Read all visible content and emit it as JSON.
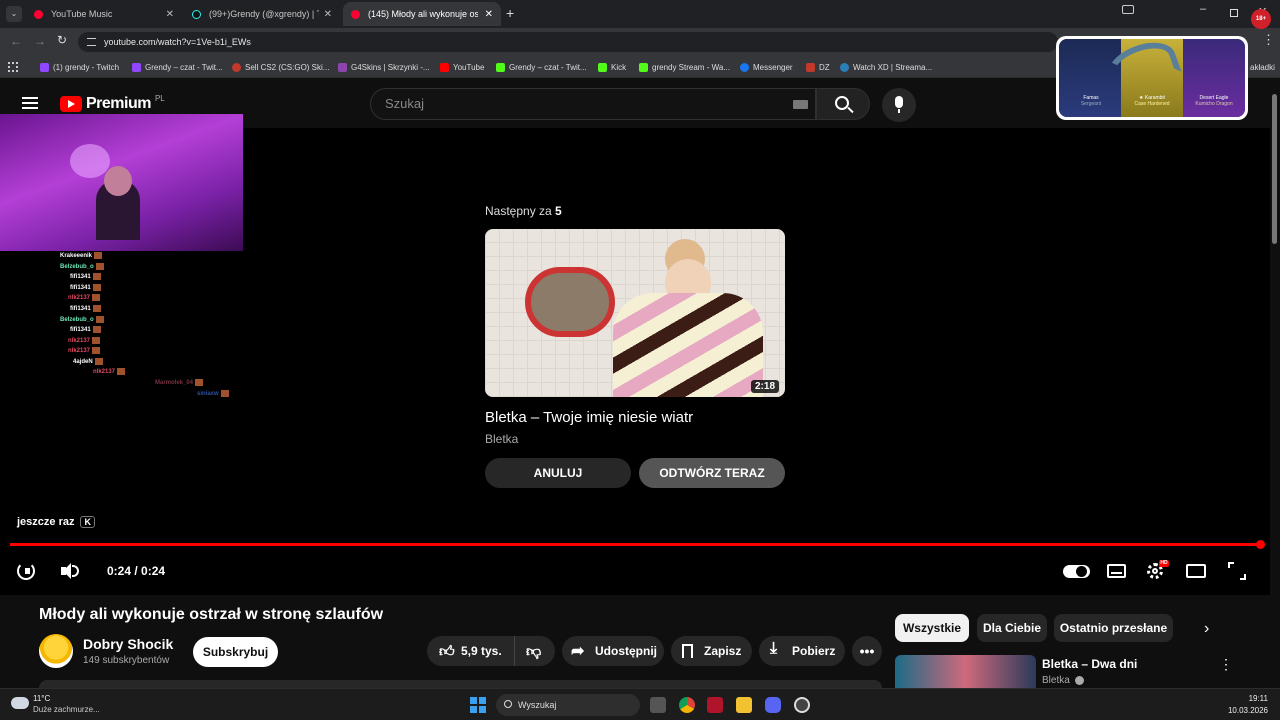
{
  "browser": {
    "tabs": [
      {
        "label": "YouTube Music",
        "active": false
      },
      {
        "label": "(99+)Grendy (@xgrendy) | TikTo",
        "active": false
      },
      {
        "label": "(145) Młody ali wykonuje ostrza",
        "active": true
      }
    ],
    "url": "youtube.com/watch?v=1Ve-b1i_EWs",
    "bookmarks": [
      "(1) grendy - Twitch",
      "Grendy – czat - Twit...",
      "Sell CS2 (CS:GO) Ski...",
      "G4Skins | Skrzynki -...",
      "YouTube",
      "Grendy – czat - Twit...",
      "Kick",
      "grendy Stream - Wa...",
      "Messenger",
      "DZ",
      "Watch XD | Streama..."
    ],
    "bookmarks_more": "akładki"
  },
  "youtube": {
    "logo": "Premium",
    "logo_region": "PL",
    "search_placeholder": "Szukaj"
  },
  "overlay_ad": {
    "items": [
      {
        "name": "Famas",
        "sub": "Sergeant"
      },
      {
        "name": "★ Karambit",
        "sub": "Case Hardened"
      },
      {
        "name": "Desert Eagle",
        "sub": "Kumicho Dragon"
      }
    ]
  },
  "chat": [
    {
      "user": "Krakeeenik",
      "color": "#ffffff"
    },
    {
      "user": "Belzebub_o",
      "color": "#6ee7b7"
    },
    {
      "user": "fifi1341",
      "color": "#ffffff"
    },
    {
      "user": "fifi1341",
      "color": "#ffffff"
    },
    {
      "user": "nlk2137",
      "color": "#e04a5f"
    },
    {
      "user": "fifi1341",
      "color": "#ffffff"
    },
    {
      "user": "Belzebub_o",
      "color": "#6ee7b7"
    },
    {
      "user": "fifi1341",
      "color": "#ffffff"
    },
    {
      "user": "nlk2137",
      "color": "#e04a5f"
    },
    {
      "user": "nlk2137",
      "color": "#e04a5f"
    },
    {
      "user": "4ajdeN",
      "color": "#ffffff"
    },
    {
      "user": "nlk2137",
      "color": "#e04a5f"
    },
    {
      "user": "Marmolek_04",
      "color": "#7a3040"
    },
    {
      "user": "siniaxw",
      "color": "#3050a0"
    }
  ],
  "player": {
    "up_next_prefix": "Następny za",
    "up_next_seconds": "5",
    "next_title": "Bletka – Twoje imię niesie wiatr",
    "next_channel": "Bletka",
    "next_duration": "2:18",
    "cancel_label": "ANULUJ",
    "play_now_label": "ODTWÓRZ TERAZ",
    "tooltip_text": "jeszcze raz",
    "tooltip_key": "K",
    "time": "0:24 / 0:24",
    "progress": 1.0,
    "accent": "#ff0000"
  },
  "video": {
    "title": "Młody ali wykonuje ostrzał w stronę szlaufów",
    "channel": "Dobry Shocik",
    "subscribers": "149 subskrybentów",
    "subscribe_label": "Subskrybuj",
    "likes": "5,9 tys.",
    "share_label": "Udostępnij",
    "save_label": "Zapisz",
    "download_label": "Pobierz"
  },
  "sidebar": {
    "chips": [
      "Wszystkie",
      "Dla Ciebie",
      "Ostatnio przesłane"
    ],
    "recommendation": {
      "title": "Bletka – Dwa dni",
      "channel": "Bletka"
    }
  },
  "taskbar": {
    "weather_temp": "11°C",
    "weather_desc": "Duże zachmurze...",
    "search_label": "Wyszukaj",
    "time": "19:11",
    "date": "10.03.2026"
  }
}
